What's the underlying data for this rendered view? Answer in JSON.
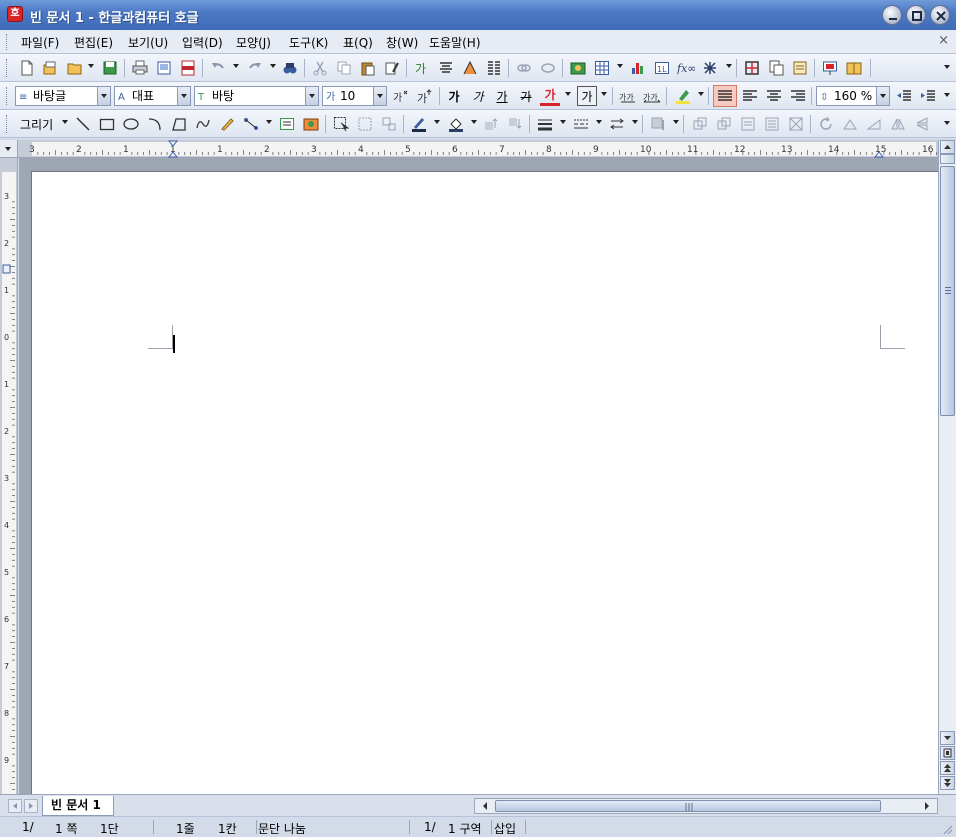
{
  "window": {
    "title": "빈 문서 1 - 한글과컴퓨터 호글",
    "app_icon_glyph": "호"
  },
  "menubar": {
    "items": [
      "파일(F)",
      "편집(E)",
      "보기(U)",
      "입력(D)",
      "모양(J)",
      "도구(K)",
      "표(Q)",
      "창(W)",
      "도움말(H)"
    ],
    "close_label": "×"
  },
  "format_toolbar": {
    "style_value": "바탕글",
    "font_lang_value": "대표",
    "font_face_value": "바탕",
    "font_size_value": "10",
    "bold_label": "가",
    "italic_label": "가",
    "underline_label": "가",
    "strike_label": "가",
    "color_label": "가",
    "outline_label": "가",
    "zoom_value": "160 %"
  },
  "draw_toolbar": {
    "label": "그리기"
  },
  "ruler": {
    "horizontal_labels": [
      "3",
      "2",
      "1",
      "1",
      "1",
      "2",
      "3",
      "4",
      "5",
      "6",
      "7",
      "8",
      "9",
      "10",
      "11",
      "12",
      "13",
      "14",
      "15",
      "16"
    ],
    "vertical_labels": [
      "3",
      "2",
      "1",
      "0",
      "1",
      "2",
      "3",
      "4",
      "5",
      "6",
      "7",
      "8",
      "9"
    ]
  },
  "document_tab": {
    "label": "빈 문서 1"
  },
  "statusbar": {
    "page": "1/",
    "page_num": "1 쪽",
    "column": "1단",
    "line": "1줄",
    "char": "1칸",
    "break_mode": "문단 나눔",
    "section_of": "1/",
    "section": "1 구역",
    "insert_mode": "삽입"
  },
  "colors": {
    "titlebar": "#4c79c4",
    "menubar_bg": "#e6ebf4",
    "font_color_red": "#d8242b",
    "highlight_yellow": "#f3e23c",
    "doc_background": "#9ea6b4"
  }
}
